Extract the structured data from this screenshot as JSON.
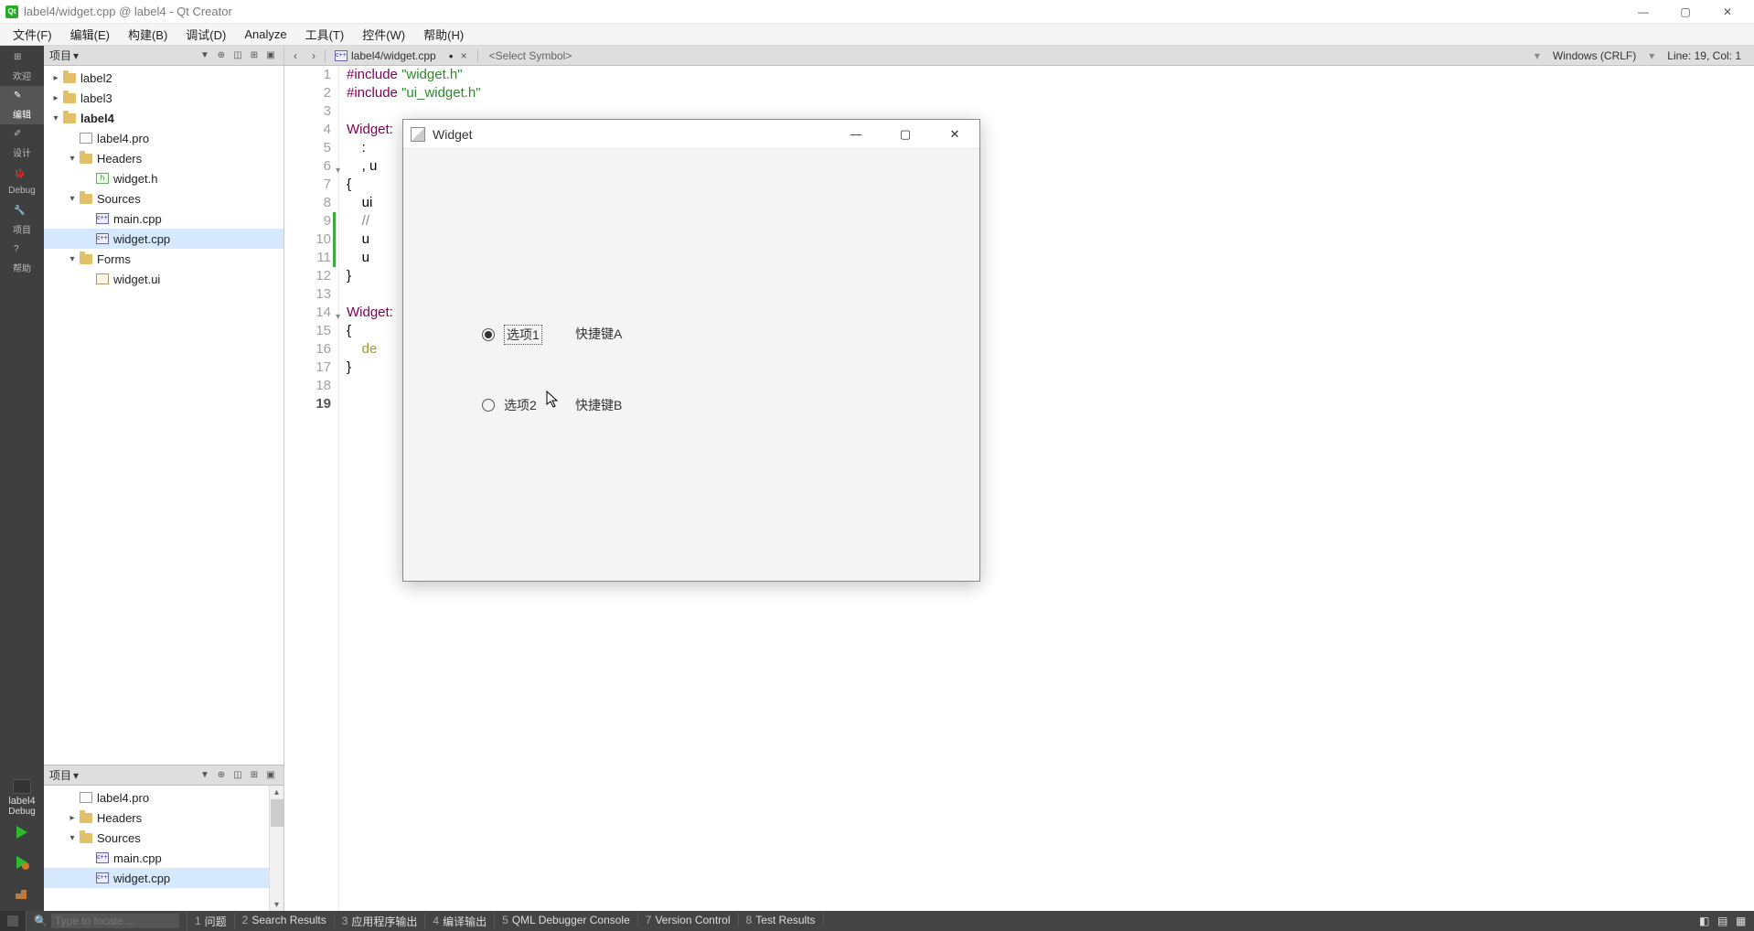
{
  "window": {
    "title": "label4/widget.cpp @ label4 - Qt Creator",
    "min": "—",
    "max": "▢",
    "close": "✕"
  },
  "menus": [
    "文件(F)",
    "编辑(E)",
    "构建(B)",
    "调试(D)",
    "Analyze",
    "工具(T)",
    "控件(W)",
    "帮助(H)"
  ],
  "modes": [
    {
      "label": "欢迎"
    },
    {
      "label": "编辑",
      "active": true
    },
    {
      "label": "设计"
    },
    {
      "label": "Debug"
    },
    {
      "label": "项目"
    },
    {
      "label": "帮助"
    }
  ],
  "kit": {
    "name": "label4",
    "config": "Debug"
  },
  "sidepanel1": {
    "title": "项目"
  },
  "sidepanel2": {
    "title": "项目"
  },
  "tree1": [
    {
      "indent": 0,
      "chev": "▸",
      "icon": "folder",
      "label": "label2"
    },
    {
      "indent": 0,
      "chev": "▸",
      "icon": "folder",
      "label": "label3"
    },
    {
      "indent": 0,
      "chev": "▾",
      "icon": "folder",
      "label": "label4",
      "bold": true
    },
    {
      "indent": 1,
      "chev": "",
      "icon": "pro",
      "label": "label4.pro"
    },
    {
      "indent": 1,
      "chev": "▾",
      "icon": "folder",
      "label": "Headers"
    },
    {
      "indent": 2,
      "chev": "",
      "icon": "h",
      "label": "widget.h"
    },
    {
      "indent": 1,
      "chev": "▾",
      "icon": "folder",
      "label": "Sources"
    },
    {
      "indent": 2,
      "chev": "",
      "icon": "cpp",
      "label": "main.cpp"
    },
    {
      "indent": 2,
      "chev": "",
      "icon": "cpp",
      "label": "widget.cpp",
      "sel": true
    },
    {
      "indent": 1,
      "chev": "▾",
      "icon": "folder",
      "label": "Forms"
    },
    {
      "indent": 2,
      "chev": "",
      "icon": "ui",
      "label": "widget.ui"
    }
  ],
  "tree2": [
    {
      "indent": 1,
      "chev": "",
      "icon": "pro",
      "label": "label4.pro"
    },
    {
      "indent": 1,
      "chev": "▸",
      "icon": "folder",
      "label": "Headers"
    },
    {
      "indent": 1,
      "chev": "▾",
      "icon": "folder",
      "label": "Sources"
    },
    {
      "indent": 2,
      "chev": "",
      "icon": "cpp",
      "label": "main.cpp"
    },
    {
      "indent": 2,
      "chev": "",
      "icon": "cpp",
      "label": "widget.cpp",
      "sel": true
    }
  ],
  "editor": {
    "nav_back": "‹",
    "nav_fwd": "›",
    "file": "label4/widget.cpp",
    "dirty": "•",
    "close": "×",
    "symbol": "<Select Symbol>",
    "encoding": "Windows (CRLF)",
    "pos": "Line: 19, Col: 1",
    "code": [
      {
        "n": 1,
        "html": "<span class='pp'>#include</span> <span class='str'>\"widget.h\"</span>"
      },
      {
        "n": 2,
        "html": "<span class='pp'>#include</span> <span class='str'>\"ui_widget.h\"</span>"
      },
      {
        "n": 3,
        "html": ""
      },
      {
        "n": 4,
        "html": "<span class='ty'>Widget:</span>"
      },
      {
        "n": 5,
        "html": "    : "
      },
      {
        "n": 6,
        "html": "    , u",
        "fold": true
      },
      {
        "n": 7,
        "html": "{"
      },
      {
        "n": 8,
        "html": "    ui"
      },
      {
        "n": 9,
        "html": "    <span class='cmt'>// </span>",
        "mark": true
      },
      {
        "n": 10,
        "html": "    u",
        "mark": true
      },
      {
        "n": 11,
        "html": "    u",
        "mark": true
      },
      {
        "n": 12,
        "html": "}"
      },
      {
        "n": 13,
        "html": ""
      },
      {
        "n": 14,
        "html": "<span class='ty'>Widget:</span>",
        "fold": true
      },
      {
        "n": 15,
        "html": "{"
      },
      {
        "n": 16,
        "html": "    <span class='kw'>de</span>"
      },
      {
        "n": 17,
        "html": "}"
      },
      {
        "n": 18,
        "html": ""
      },
      {
        "n": 19,
        "html": "",
        "current": true
      }
    ]
  },
  "app": {
    "title": "Widget",
    "min": "—",
    "max": "▢",
    "close": "✕",
    "radio1": {
      "label": "选项1",
      "shortcut": "快捷键A",
      "checked": true
    },
    "radio2": {
      "label": "选项2",
      "shortcut": "快捷键B",
      "checked": false
    }
  },
  "bottom": {
    "search_ph": "Type to locate ...",
    "panes": [
      {
        "n": "1",
        "t": "问题"
      },
      {
        "n": "2",
        "t": "Search Results"
      },
      {
        "n": "3",
        "t": "应用程序输出"
      },
      {
        "n": "4",
        "t": "编译输出"
      },
      {
        "n": "5",
        "t": "QML Debugger Console"
      },
      {
        "n": "7",
        "t": "Version Control"
      },
      {
        "n": "8",
        "t": "Test Results"
      }
    ]
  }
}
